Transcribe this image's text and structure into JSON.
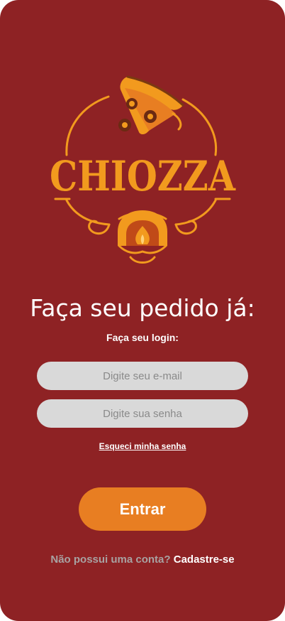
{
  "brand": {
    "logo_text": "CHIOZZA",
    "primary_color": "#8e2224",
    "accent_color": "#e87e22",
    "logo_color": "#f29a1e"
  },
  "login": {
    "headline": "Faça seu pedido já:",
    "subheadline": "Faça seu login:",
    "email_placeholder": "Digite seu e-mail",
    "password_placeholder": "Digite sua senha",
    "forgot_password": "Esqueci minha senha",
    "submit_label": "Entrar",
    "signup_prompt": "Não possui uma conta?",
    "signup_link": "Cadastre-se"
  }
}
